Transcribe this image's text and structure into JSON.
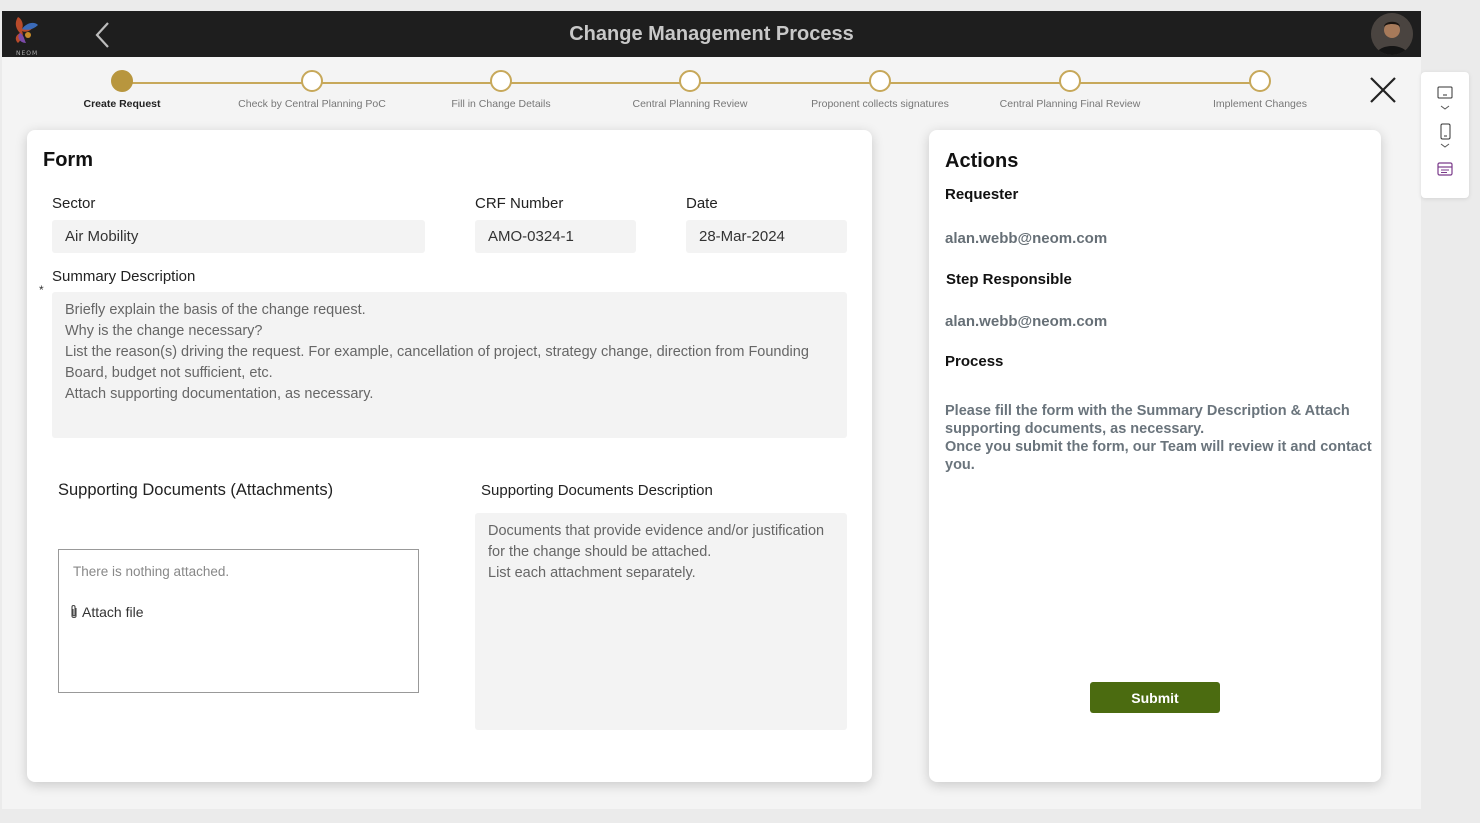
{
  "header": {
    "title": "Change Management Process",
    "logo_text": "NEOM"
  },
  "stepper": {
    "steps": [
      {
        "label": "Create Request",
        "state": "current"
      },
      {
        "label": "Check by Central Planning PoC",
        "state": "pending"
      },
      {
        "label": "Fill in Change Details",
        "state": "pending"
      },
      {
        "label": "Central Planning Review",
        "state": "pending"
      },
      {
        "label": "Proponent collects signatures",
        "state": "pending"
      },
      {
        "label": "Central Planning Final Review",
        "state": "pending"
      },
      {
        "label": "Implement Changes",
        "state": "pending"
      }
    ]
  },
  "form": {
    "title": "Form",
    "sector": {
      "label": "Sector",
      "value": "Air Mobility"
    },
    "crf_number": {
      "label": "CRF Number",
      "value": "AMO-0324-1"
    },
    "date": {
      "label": "Date",
      "value": "28-Mar-2024"
    },
    "summary": {
      "required_marker": "*",
      "label": "Summary Description",
      "placeholder": "Briefly explain the basis of the change request.\nWhy is the change necessary?\nList the reason(s) driving the request. For example, cancellation of project, strategy change, direction from Founding Board, budget not sufficient, etc.\nAttach supporting documentation, as necessary."
    },
    "attachments": {
      "label": "Supporting Documents (Attachments)",
      "empty_text": "There is nothing attached.",
      "attach_label": "Attach file"
    },
    "docs_description": {
      "label": "Supporting Documents Description",
      "placeholder": "Documents that provide evidence and/or justification for the change should be attached.\nList each attachment separately."
    }
  },
  "actions": {
    "title": "Actions",
    "requester": {
      "label": "Requester",
      "value": "alan.webb@neom.com"
    },
    "step_responsible": {
      "label": "Step Responsible",
      "value": "alan.webb@neom.com"
    },
    "process": {
      "label": "Process",
      "text": "Please fill the form with the Summary Description & Attach supporting documents, as necessary.\nOnce you submit the form, our Team will review it and contact you."
    },
    "submit_label": "Submit"
  },
  "colors": {
    "header_bg": "#1e1e1e",
    "stepper_accent": "#c7a85a",
    "step_done": "#b8963e",
    "submit_bg": "#4b6b10"
  },
  "icons": {
    "back": "chevron-left-icon",
    "close": "close-icon",
    "attach": "paperclip-icon",
    "side": [
      "tablet-landscape-icon",
      "phone-icon",
      "form-icon"
    ]
  }
}
